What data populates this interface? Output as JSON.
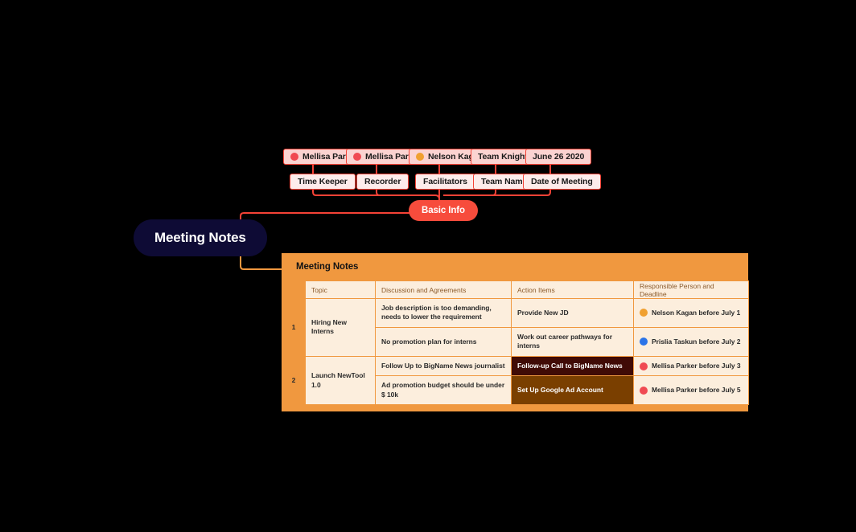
{
  "root": {
    "label": "Meeting Notes"
  },
  "branch": {
    "label": "Basic Info"
  },
  "basic_info_fields": [
    {
      "label": "Time Keeper",
      "value": "Mellisa Parker",
      "avatar": "person-avatar-icon",
      "avatar_color": "#F04A52"
    },
    {
      "label": "Recorder",
      "value": "Mellisa Parker",
      "avatar": "person-avatar-icon",
      "avatar_color": "#F04A52"
    },
    {
      "label": "Facilitators",
      "value": "Nelson Kagan",
      "avatar": "person-avatar-icon",
      "avatar_color": "#F0A030"
    },
    {
      "label": "Team Name",
      "value": "Team Knight",
      "avatar": null,
      "avatar_color": null
    },
    {
      "label": "Date of Meeting",
      "value": "June 26 2020",
      "avatar": null,
      "avatar_color": null
    }
  ],
  "notes_card": {
    "title": "Meeting Notes",
    "columns": {
      "index": "",
      "topic": "Topic",
      "discussion": "Discussion and Agreements",
      "action": "Action Items",
      "responsible": "Responsible Person and Deadline"
    },
    "rows": [
      {
        "index": "1",
        "topic": "Hiring New Interns",
        "entries": [
          {
            "discussion": "Job description is too demanding, needs to lower the requirement",
            "action": "Provide New JD",
            "action_highlight": "none",
            "responsible": "Nelson Kagan before July 1",
            "avatar": "person-avatar-icon",
            "avatar_color": "#F0A030"
          },
          {
            "discussion": "No promotion plan for interns",
            "action": "Work out career pathways for interns",
            "action_highlight": "none",
            "responsible": "Prislia Taskun before July 2",
            "avatar": "person-avatar-icon",
            "avatar_color": "#2B74E8"
          }
        ]
      },
      {
        "index": "2",
        "topic": "Launch NewTool 1.0",
        "entries": [
          {
            "discussion": "Follow Up to BigName News journalist",
            "action": "Follow-up Call to BigName News",
            "action_highlight": "maroon",
            "responsible": "Mellisa Parker before July 3",
            "avatar": "person-avatar-icon",
            "avatar_color": "#F04A52"
          },
          {
            "discussion": "Ad promotion budget should be under $ 10k",
            "action": "Set Up Google Ad Account",
            "action_highlight": "brown",
            "responsible": "Mellisa Parker before July 5",
            "avatar": "person-avatar-icon",
            "avatar_color": "#F04A52"
          }
        ]
      }
    ]
  },
  "colors": {
    "background": "#000000",
    "root_navy": "#0E0B35",
    "branch_red": "#F74C3C",
    "line_red": "#F54236",
    "line_orange": "#F0983F",
    "chip_value_bg": "#FBD3D1",
    "chip_label_bg": "#FDECEB",
    "card_orange": "#F0983F",
    "cell_cream": "#FCEEDD",
    "header_brown_text": "#8A5A2B",
    "highlight_maroon": "#400B06",
    "highlight_brown": "#7A3F00"
  }
}
